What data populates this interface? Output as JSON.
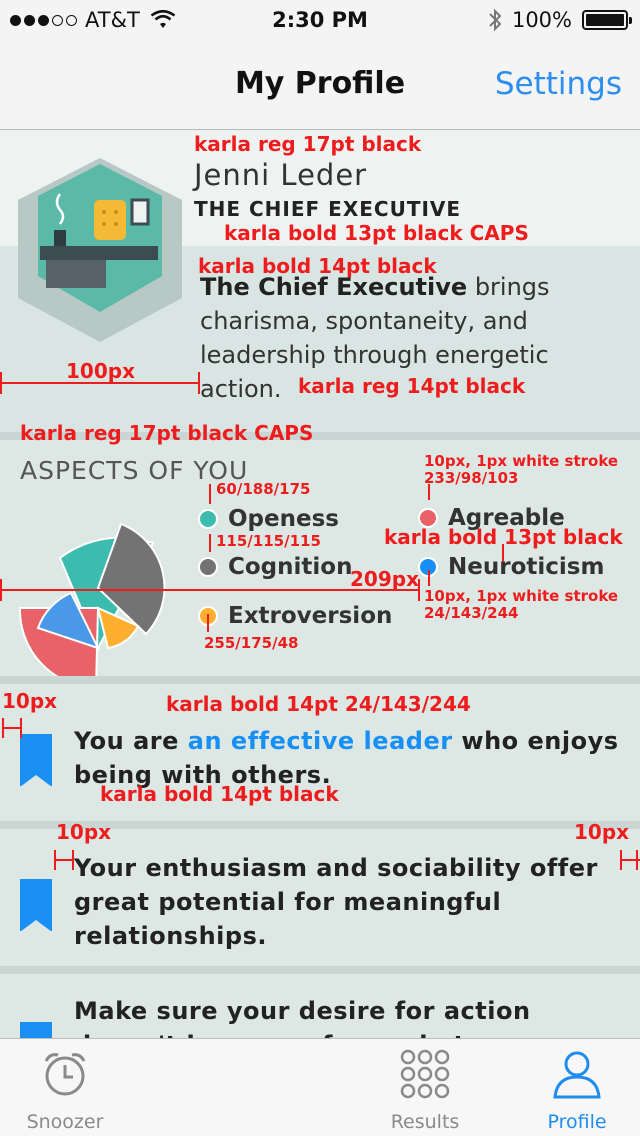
{
  "status": {
    "carrier": "AT&T",
    "time": "2:30 PM",
    "battery": "100%"
  },
  "nav": {
    "title": "My Profile",
    "settings_label": "Settings"
  },
  "profile": {
    "name": "Jenni Leder",
    "title": "THE CHIEF EXECUTIVE",
    "desc_bold": "The Chief Executive",
    "desc_rest": " brings charisma, spontaneity, and leadership through energetic action."
  },
  "aspects": {
    "heading": "ASPECTS OF YOU",
    "items": [
      {
        "label": "Openess",
        "color": "#3cbcaf"
      },
      {
        "label": "Cognition",
        "color": "#737373"
      },
      {
        "label": "Extroversion",
        "color": "#ffaf30"
      },
      {
        "label": "Agreable",
        "color": "#e96267"
      },
      {
        "label": "Neuroticism",
        "color": "#188ff4"
      }
    ]
  },
  "insights": [
    {
      "pre": "You are ",
      "highlight": "an effective leader",
      "post": " who enjoys being with others."
    },
    {
      "text": "Your enthusiasm and sociability offer great potential for meaningful relationships."
    },
    {
      "text": "Make sure your desire for action doesn't keep you from whatever analysis may be"
    }
  ],
  "tabs": [
    {
      "label": "Snoozer"
    },
    {
      "label": "Results"
    },
    {
      "label": "Profile"
    }
  ],
  "annotations": {
    "a1": "karla reg 17pt black",
    "a2": "karla bold 13pt black CAPS",
    "a3": "karla bold 14pt black",
    "a4": "100px",
    "a5": "karla reg 14pt black",
    "a6": "karla reg 17pt black CAPS",
    "a7": "60/188/175",
    "a8": "10px, 1px white stroke",
    "a9": "233/98/103",
    "a10": "115/115/115",
    "a11": "karla bold 13pt black",
    "a12": "209px",
    "a13": "10px, 1px white stroke",
    "a14": "24/143/244",
    "a15": "255/175/48",
    "a16": "10px",
    "a17": "karla bold 14pt 24/143/244",
    "a18": "karla bold 14pt black",
    "a19": "10px",
    "a20": "10px"
  }
}
